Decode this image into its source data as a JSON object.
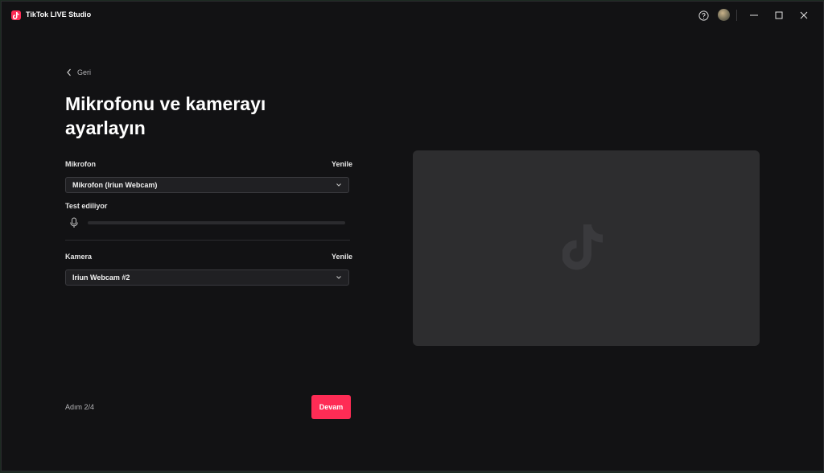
{
  "window": {
    "app_title": "TikTok LIVE Studio"
  },
  "nav": {
    "back_label": "Geri"
  },
  "page": {
    "title": "Mikrofonu ve kamerayı ayarlayın"
  },
  "microphone": {
    "label": "Mikrofon",
    "refresh_label": "Yenile",
    "selected": "Mikrofon (Iriun Webcam)",
    "test_label": "Test ediliyor",
    "level": 0
  },
  "camera": {
    "label": "Kamera",
    "refresh_label": "Yenile",
    "selected": "Iriun Webcam #2"
  },
  "footer": {
    "step_label": "Adım 2/4",
    "continue_label": "Devam"
  },
  "icons": {
    "app": "tiktok-logo-icon",
    "help": "help-icon",
    "minimize": "minimize-icon",
    "maximize": "maximize-icon",
    "close": "close-icon",
    "back": "chevron-left-icon",
    "dropdown": "chevron-down-icon",
    "mic": "microphone-icon",
    "preview": "tiktok-logo-icon"
  },
  "colors": {
    "accent": "#fe2c55",
    "background": "#121214",
    "preview": "#2d2d2f"
  }
}
